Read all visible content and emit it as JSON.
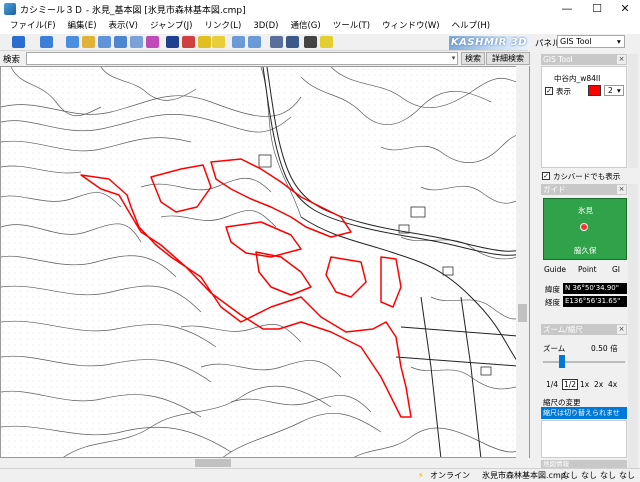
{
  "window": {
    "title": "カシミール３Ｄ - 氷見_基本図 [氷見市森林基本図.cmp]",
    "min_glyph": "—",
    "max_glyph": "☐",
    "close_glyph": "✕"
  },
  "menu": [
    "ファイル(F)",
    "編集(E)",
    "表示(V)",
    "ジャンプ(J)",
    "リンク(L)",
    "3D(D)",
    "通信(G)",
    "ツール(T)",
    "ウィンドウ(W)",
    "ヘルプ(H)"
  ],
  "toolbar": {
    "logo_text": "KASHMIR 3D"
  },
  "search": {
    "label": "検索",
    "value": "",
    "dropdown_glyph": "▾",
    "search_button": "検索",
    "detail_button": "詳細検索"
  },
  "panel": {
    "label": "パネル",
    "selected": "GIS Tool",
    "dropdown_glyph": "▾",
    "gis": {
      "header": "GIS Tool",
      "layer_name": "中谷内_w84II",
      "show_label": "表示",
      "color": "#ff0000",
      "width_value": "2",
      "also_show_label": "カシバードでも表示",
      "check_glyph": "✓"
    },
    "guide": {
      "header": "ガイド",
      "place_top": "氷見",
      "place_bottom": "脇久保",
      "tabs": [
        "Guide",
        "Point",
        "GI"
      ],
      "lat_label": "緯度",
      "lat_value": "N 36°50'34.90\"",
      "lon_label": "経度",
      "lon_value": "E136°56'31.65\""
    },
    "zoom": {
      "header": "ズーム/縮尺",
      "label": "ズーム",
      "value": "0.50 倍",
      "buttons": [
        "1/4",
        "1/2",
        "1x",
        "2x",
        "4x"
      ],
      "active_button": "1/2",
      "scale_change_label": "縮尺の変更",
      "scale_message": "縮尺は切り替えられませ"
    },
    "bottom_header": "地図情報"
  },
  "status": {
    "online": "オンライン",
    "file": "氷見市森林基本図.cmp",
    "fields": [
      "なし",
      "なし",
      "なし",
      "なし"
    ]
  },
  "colors": {
    "boundary": "#ff0000",
    "contour": "#555555",
    "map_background": "#ffffff",
    "guide_map": "#2fa24a"
  }
}
